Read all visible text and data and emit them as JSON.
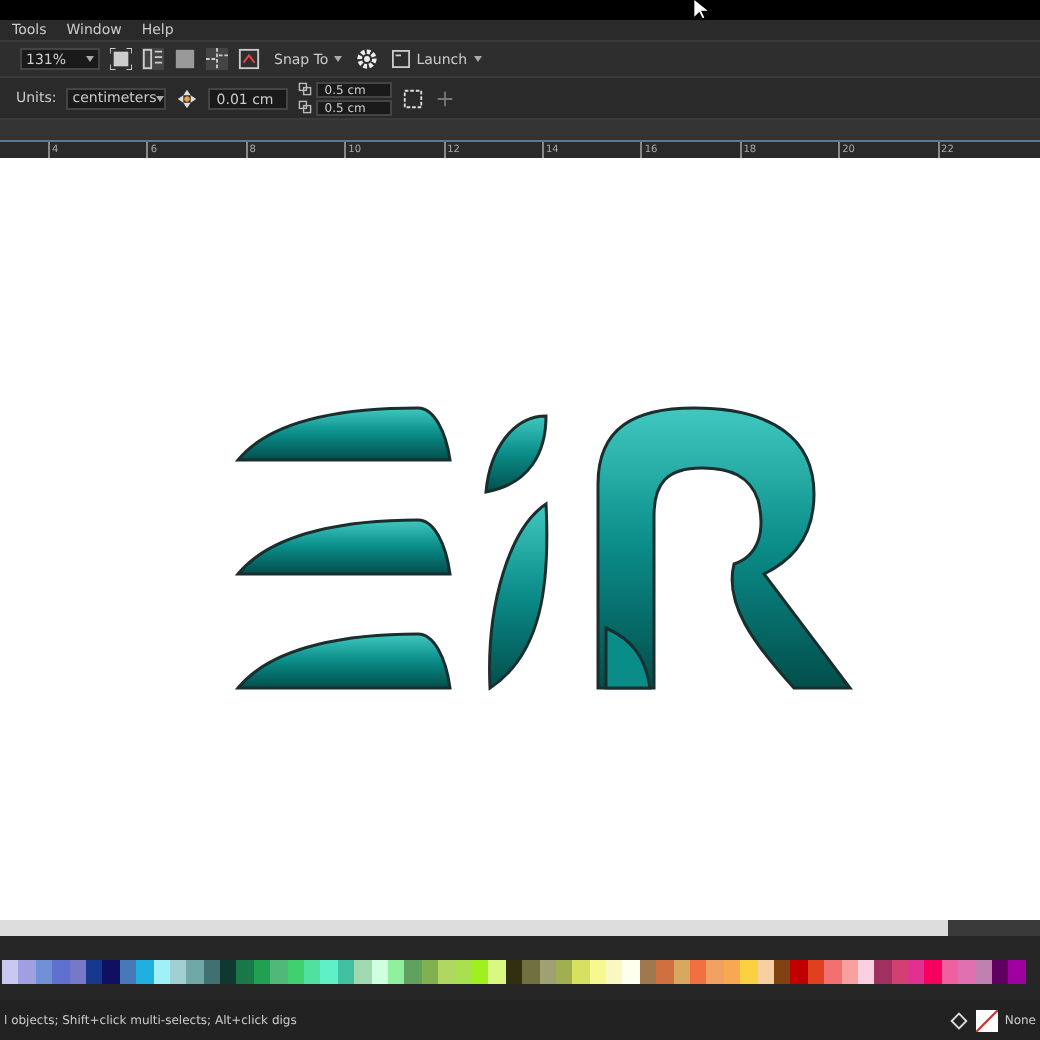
{
  "menu": [
    "Tools",
    "Window",
    "Help"
  ],
  "toolbar": {
    "zoom": "131%",
    "snap": "Snap To",
    "launch": "Launch"
  },
  "property_bar": {
    "units_label": "Units:",
    "units": "centimeters",
    "nudge": "0.01 cm",
    "dup_x": "0.5 cm",
    "dup_y": "0.5 cm"
  },
  "ruler": [
    "4",
    "6",
    "8",
    "10",
    "12",
    "14",
    "16",
    "18",
    "20",
    "22"
  ],
  "palette": [
    {
      "color": "#c8c8f0"
    },
    {
      "color": "#a0a0e0"
    },
    {
      "color": "#7090d8"
    },
    {
      "color": "#6070d0"
    },
    {
      "color": "#7878c8"
    },
    {
      "color": "#183890"
    },
    {
      "color": "#101060"
    },
    {
      "color": "#4878b8"
    },
    {
      "color": "#20b0e0"
    },
    {
      "color": "#a0f0f8"
    },
    {
      "color": "#a0d0d0"
    },
    {
      "color": "#70a8a8"
    },
    {
      "color": "#407070"
    },
    {
      "color": "#103830"
    },
    {
      "color": "#187848"
    },
    {
      "color": "#20a050"
    },
    {
      "color": "#50b878"
    },
    {
      "color": "#40d070"
    },
    {
      "color": "#50e0a0"
    },
    {
      "color": "#60f0c8"
    },
    {
      "color": "#40c0a0"
    },
    {
      "color": "#a0d8b0"
    },
    {
      "color": "#d0ffe0"
    },
    {
      "color": "#90f0a0"
    },
    {
      "color": "#60a060"
    },
    {
      "color": "#80b050"
    },
    {
      "color": "#b0d860"
    },
    {
      "color": "#a8e050"
    },
    {
      "color": "#a0f020"
    },
    {
      "color": "#d8f880"
    },
    {
      "color": "#303010"
    },
    {
      "color": "#707040"
    },
    {
      "color": "#a0a070"
    },
    {
      "color": "#a0b050"
    },
    {
      "color": "#d8e060"
    },
    {
      "color": "#f8f890"
    },
    {
      "color": "#f8f8c0"
    },
    {
      "color": "#fffff0"
    },
    {
      "color": "#a07850"
    },
    {
      "color": "#d07040"
    },
    {
      "color": "#d8a860"
    },
    {
      "color": "#f07040"
    },
    {
      "color": "#f0a060"
    },
    {
      "color": "#f8a850"
    },
    {
      "color": "#f8d040"
    },
    {
      "color": "#f8d0a0"
    },
    {
      "color": "#804010"
    },
    {
      "color": "#c00000"
    },
    {
      "color": "#e04020"
    },
    {
      "color": "#f07070"
    },
    {
      "color": "#f8a0a0"
    },
    {
      "color": "#f8d0e0"
    },
    {
      "color": "#a03060"
    },
    {
      "color": "#d04070"
    },
    {
      "color": "#e03090"
    },
    {
      "color": "#f80060"
    },
    {
      "color": "#f060a0"
    },
    {
      "color": "#e070b0"
    },
    {
      "color": "#c080b0"
    },
    {
      "color": "#600060"
    },
    {
      "color": "#a000a0"
    }
  ],
  "status_bar": {
    "hint": "l objects; Shift+click multi-selects; Alt+click digs",
    "fill": "None"
  }
}
